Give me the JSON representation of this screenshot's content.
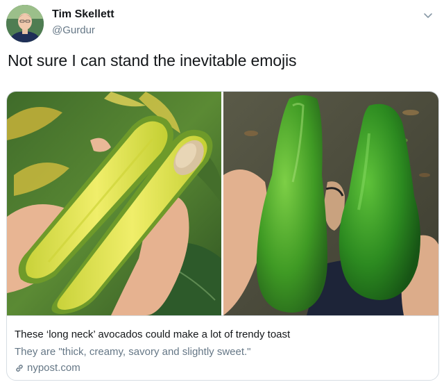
{
  "user": {
    "name": "Tim Skellett",
    "handle": "@Gurdur"
  },
  "tweet": {
    "text": "Not sure I can stand the inevitable emojis"
  },
  "card": {
    "title": "These ‘long neck’ avocados could make a lot of trendy toast",
    "description": "They are \"thick, creamy, savory and slightly sweet.\"",
    "domain": "nypost.com"
  },
  "icons": {
    "menu": "chevron-down-icon",
    "link": "link-icon"
  },
  "colors": {
    "text": "#14171a",
    "secondary": "#657786",
    "border": "#d6dde3"
  }
}
